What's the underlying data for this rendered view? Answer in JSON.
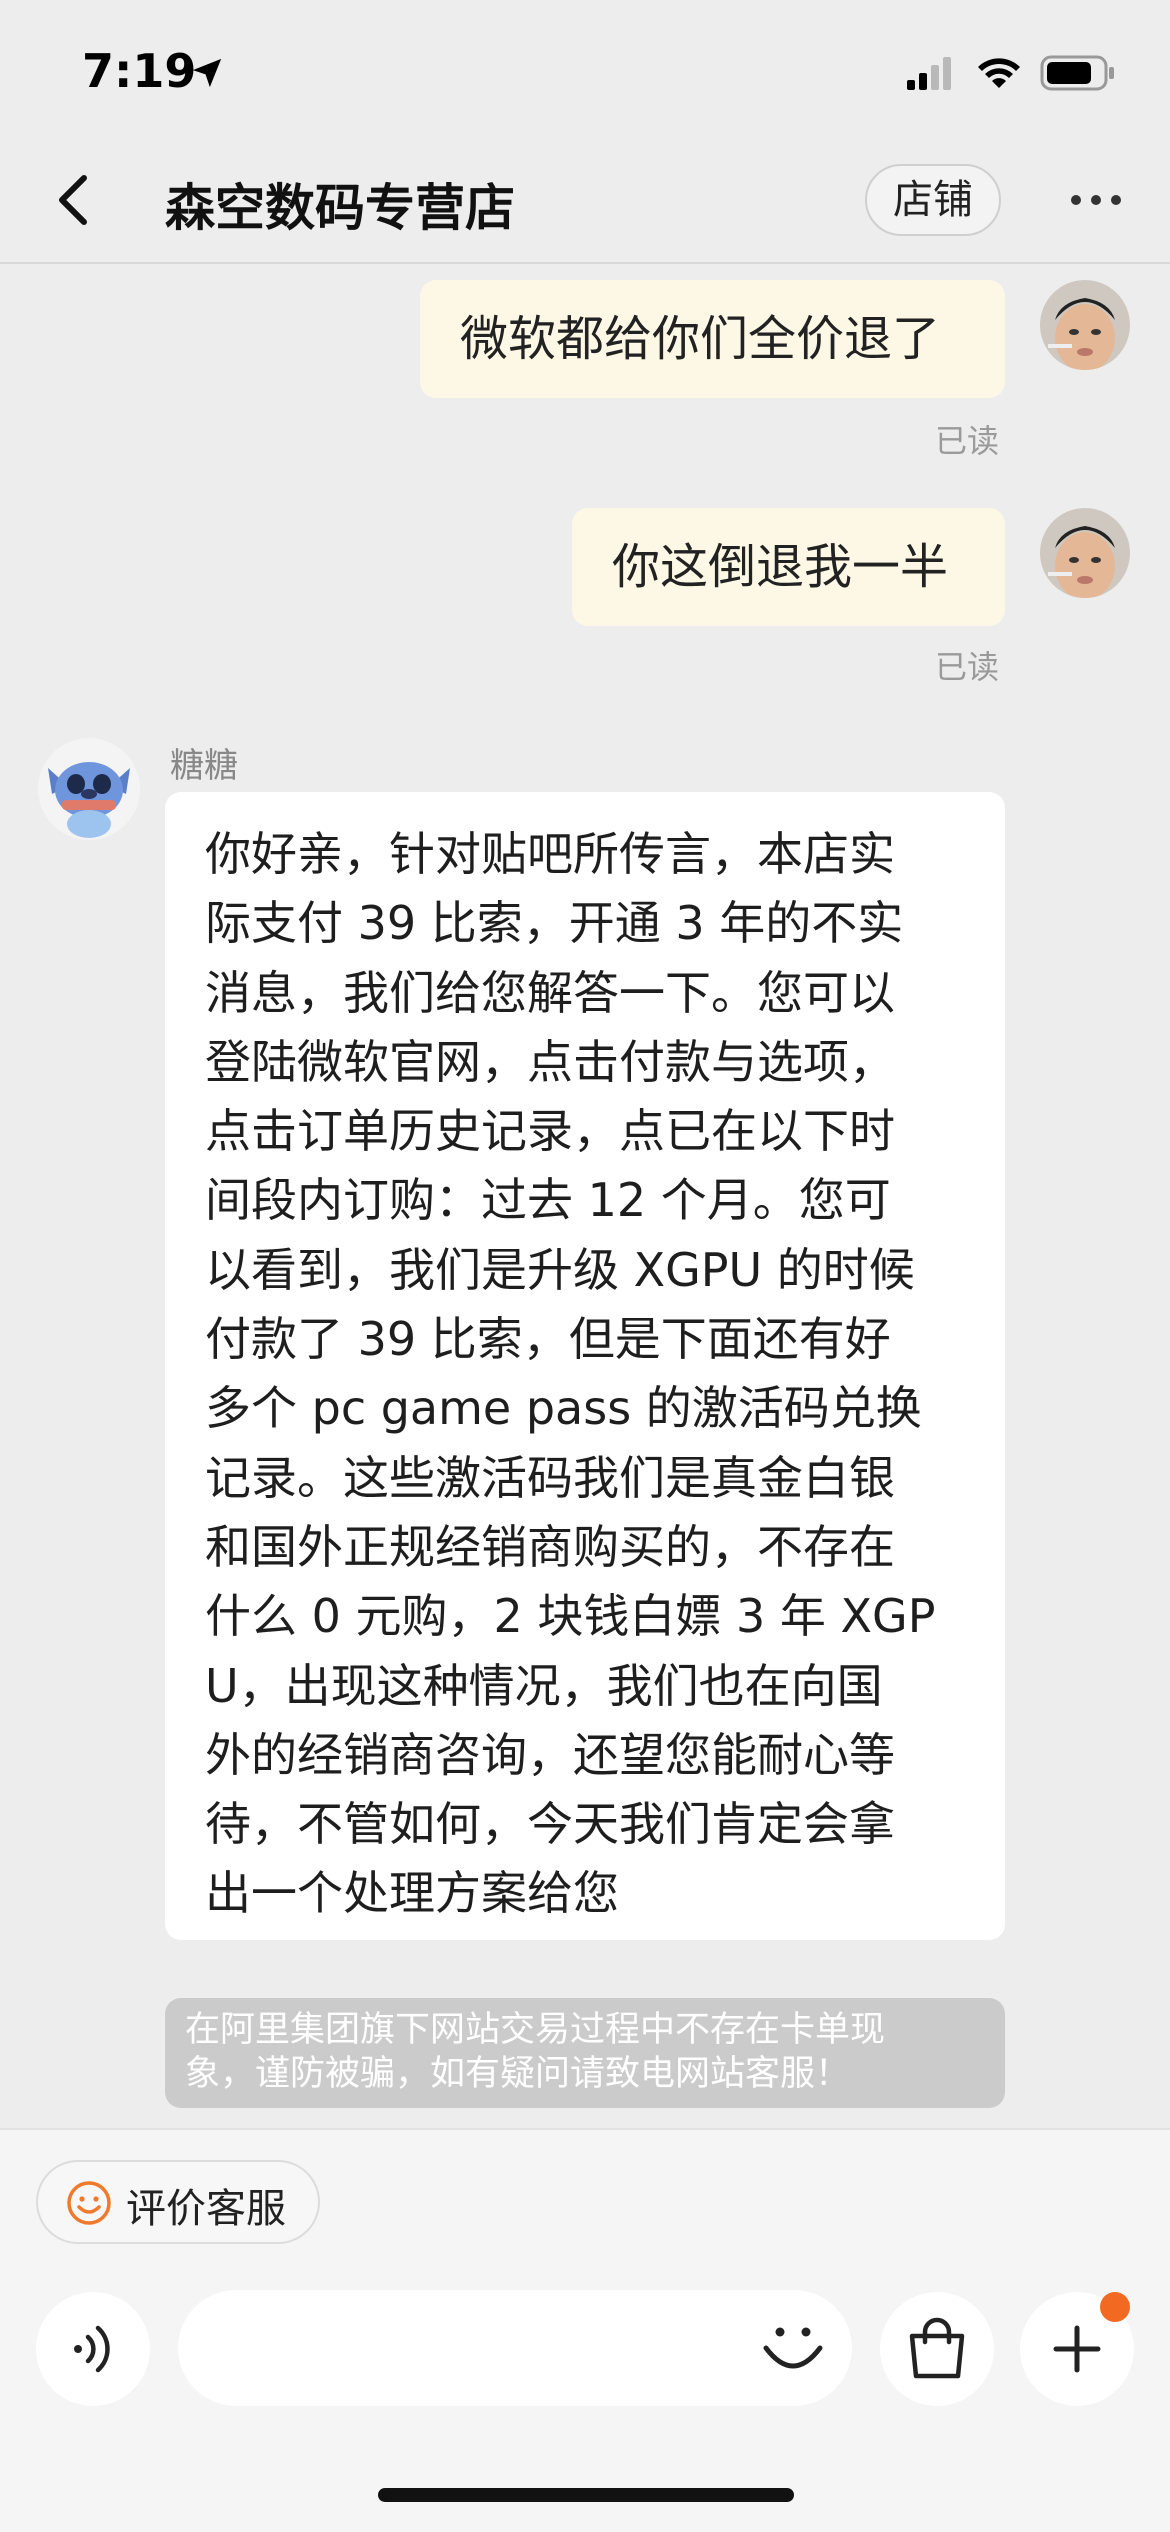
{
  "status_bar": {
    "time": "7:19"
  },
  "header": {
    "title": "森空数码专营店",
    "shop_button": "店铺"
  },
  "messages": {
    "outgoing": [
      {
        "text": "微软都给你们全价退了",
        "status": "已读"
      },
      {
        "text": "你这倒退我一半",
        "status": "已读"
      }
    ],
    "incoming": {
      "sender": "糖糖",
      "lines": [
        "你好亲，针对贴吧所传言，本店实",
        "际支付 39 比索，开通 3 年的不实",
        "消息，我们给您解答一下。您可以",
        "登陆微软官网，点击付款与选项，",
        "点击订单历史记录，点已在以下时",
        "间段内订购：过去 12 个月。您可",
        "以看到，我们是升级 XGPU 的时候",
        "付款了 39 比索，但是下面还有好",
        "多个 pc game pass 的激活码兑换",
        "记录。这些激活码我们是真金白银",
        "和国外正规经销商购买的，不存在",
        "什么 0 元购，2 块钱白嫖 3 年 XGP",
        "U，出现这种情况，我们也在向国",
        "外的经销商咨询，还望您能耐心等",
        "待，不管如何，今天我们肯定会拿",
        "出一个处理方案给您"
      ]
    },
    "notice": {
      "line1": "在阿里集团旗下网站交易过程中不存在卡单现",
      "line2": "象，谨防被骗，如有疑问请致电网站客服！"
    }
  },
  "bottom": {
    "rate_button": "评价客服",
    "input_placeholder": ""
  },
  "colors": {
    "background": "#ededed",
    "outgoing_bubble": "#fdf7e6",
    "incoming_bubble": "#ffffff",
    "notice_bg": "#cbcbcb",
    "accent": "#f26a22",
    "rate_icon": "#f07a2c"
  },
  "icons": [
    "location-arrow-icon",
    "signal-icon",
    "wifi-icon",
    "battery-icon",
    "back-chevron-icon",
    "more-dots-icon",
    "smiley-icon",
    "voice-icon",
    "emoji-icon",
    "shopping-bag-icon",
    "plus-icon"
  ]
}
